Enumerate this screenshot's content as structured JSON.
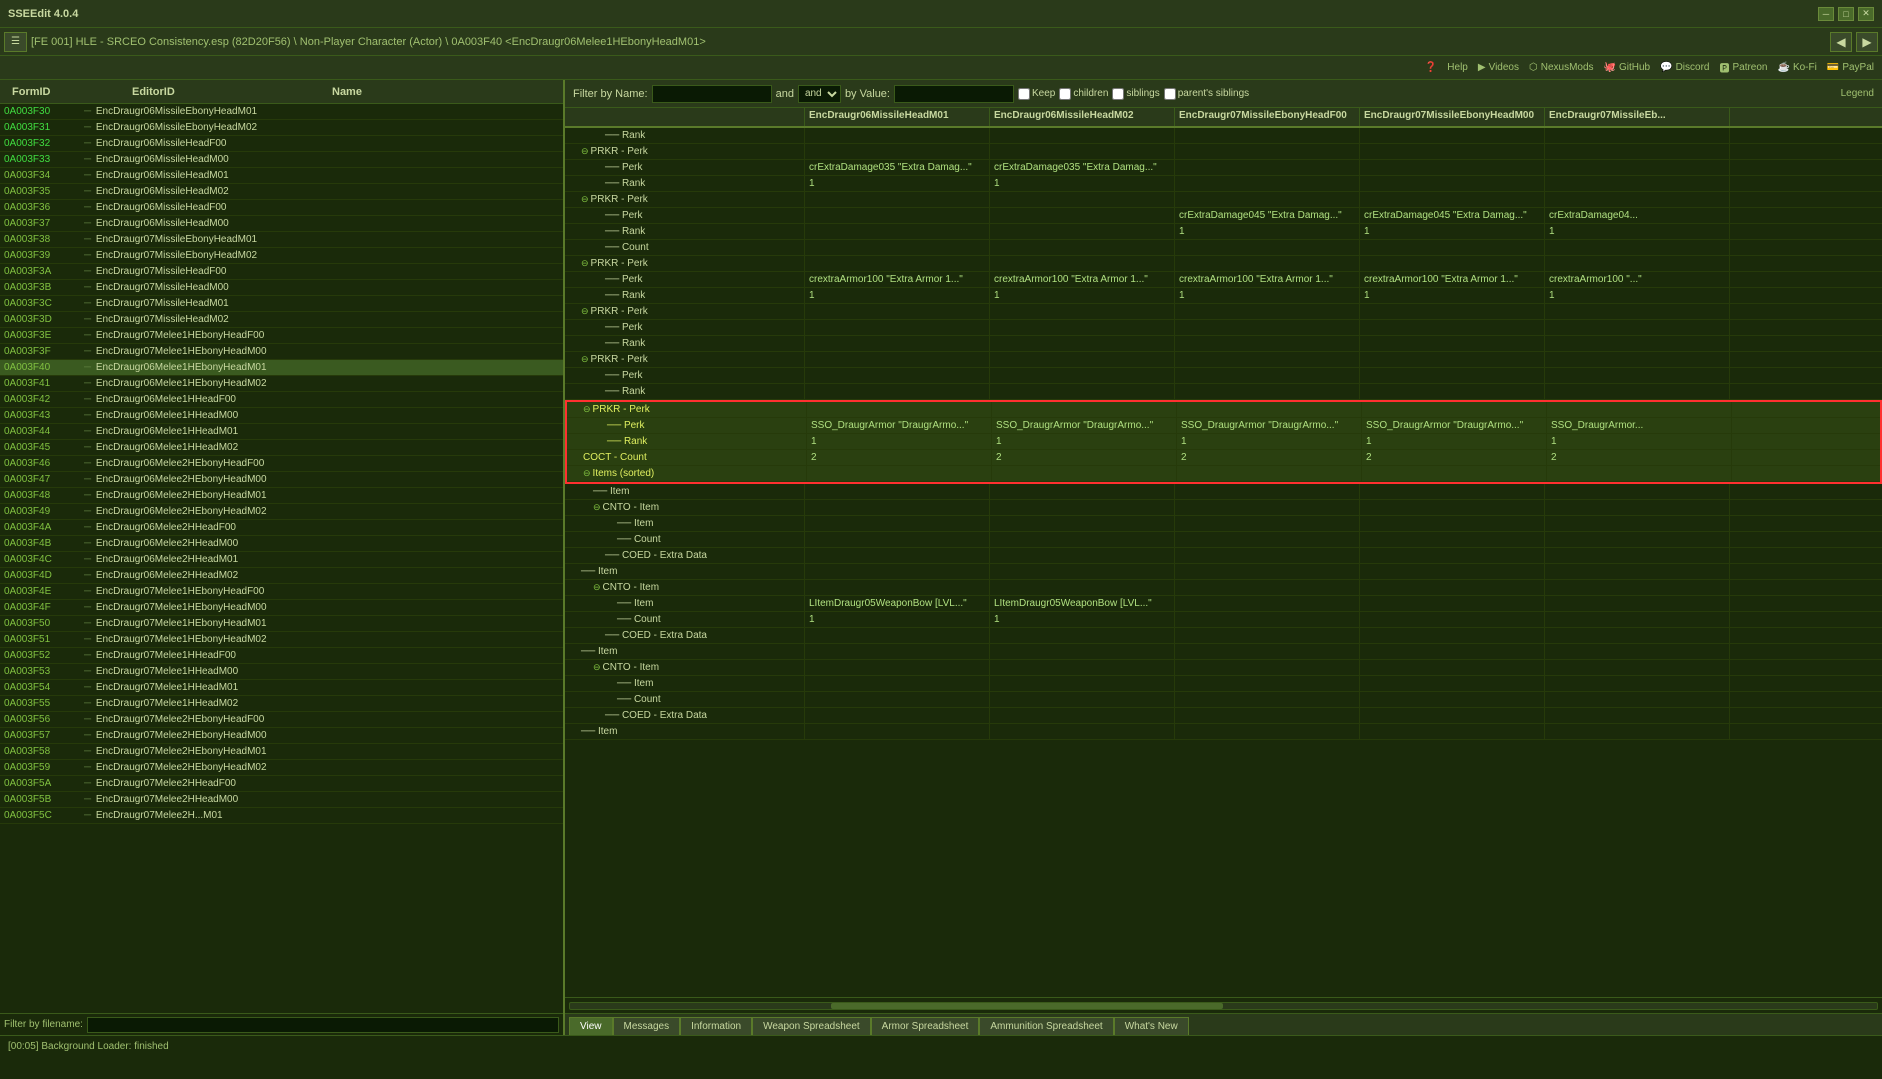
{
  "app": {
    "title": "SSEEdit 4.0.4",
    "version": "4.0.4"
  },
  "window_controls": {
    "minimize": "─",
    "maximize": "□",
    "close": "✕"
  },
  "toolbar": {
    "menu_btn": "☰",
    "breadcrumb": "[FE 001] HLE - SRCEO Consistency.esp (82D20F56) \\ Non-Player Character (Actor) \\ 0A003F40 <EncDraugr06Melee1HEbonyHeadM01>",
    "nav_back": "◀",
    "nav_fwd": "▶"
  },
  "help_toolbar": {
    "help": "Help",
    "videos": "Videos",
    "nexusmods": "NexusMods",
    "github": "GitHub",
    "discord": "Discord",
    "patreon": "Patreon",
    "ko_fi": "Ko-Fi",
    "paypal": "PayPal"
  },
  "left_panel": {
    "col_formid": "FormID",
    "col_editorid": "EditorID",
    "col_name": "Name",
    "filter_label": "Filter by filename:",
    "rows": [
      {
        "formid": "0A003F30",
        "editorid": "EncDraugr06MissileEbonyHeadM01",
        "selected": false,
        "green": true
      },
      {
        "formid": "0A003F31",
        "editorid": "EncDraugr06MissileEbonyHeadM02",
        "selected": false,
        "green": true
      },
      {
        "formid": "0A003F32",
        "editorid": "EncDraugr06MissileHeadF00",
        "selected": false,
        "green": true
      },
      {
        "formid": "0A003F33",
        "editorid": "EncDraugr06MissileHeadM00",
        "selected": false,
        "green": true
      },
      {
        "formid": "0A003F34",
        "editorid": "EncDraugr06MissileHeadM01",
        "selected": false,
        "green": false
      },
      {
        "formid": "0A003F35",
        "editorid": "EncDraugr06MissileHeadM02",
        "selected": false,
        "green": false
      },
      {
        "formid": "0A003F36",
        "editorid": "EncDraugr06MissileHeadF00",
        "selected": false,
        "green": false
      },
      {
        "formid": "0A003F37",
        "editorid": "EncDraugr06MissileHeadM00",
        "selected": false,
        "green": false
      },
      {
        "formid": "0A003F38",
        "editorid": "EncDraugr07MissileEbonyHeadM01",
        "selected": false,
        "green": false
      },
      {
        "formid": "0A003F39",
        "editorid": "EncDraugr07MissileEbonyHeadM02",
        "selected": false,
        "green": false
      },
      {
        "formid": "0A003F3A",
        "editorid": "EncDraugr07MissileHeadF00",
        "selected": false,
        "green": false
      },
      {
        "formid": "0A003F3B",
        "editorid": "EncDraugr07MissileHeadM00",
        "selected": false,
        "green": false
      },
      {
        "formid": "0A003F3C",
        "editorid": "EncDraugr07MissileHeadM01",
        "selected": false,
        "green": false
      },
      {
        "formid": "0A003F3D",
        "editorid": "EncDraugr07MissileHeadM02",
        "selected": false,
        "green": false
      },
      {
        "formid": "0A003F3E",
        "editorid": "EncDraugr07Melee1HEbonyHeadF00",
        "selected": false,
        "green": false
      },
      {
        "formid": "0A003F3F",
        "editorid": "EncDraugr07Melee1HEbonyHeadM00",
        "selected": false,
        "green": false
      },
      {
        "formid": "0A003F40",
        "editorid": "EncDraugr06Melee1HEbonyHeadM01",
        "selected": true,
        "green": false
      },
      {
        "formid": "0A003F41",
        "editorid": "EncDraugr06Melee1HEbonyHeadM02",
        "selected": false,
        "green": false
      },
      {
        "formid": "0A003F42",
        "editorid": "EncDraugr06Melee1HHeadF00",
        "selected": false,
        "green": false
      },
      {
        "formid": "0A003F43",
        "editorid": "EncDraugr06Melee1HHeadM00",
        "selected": false,
        "green": false
      },
      {
        "formid": "0A003F44",
        "editorid": "EncDraugr06Melee1HHeadM01",
        "selected": false,
        "green": false
      },
      {
        "formid": "0A003F45",
        "editorid": "EncDraugr06Melee1HHeadM02",
        "selected": false,
        "green": false
      },
      {
        "formid": "0A003F46",
        "editorid": "EncDraugr06Melee2HEbonyHeadF00",
        "selected": false,
        "green": false
      },
      {
        "formid": "0A003F47",
        "editorid": "EncDraugr06Melee2HEbonyHeadM00",
        "selected": false,
        "green": false
      },
      {
        "formid": "0A003F48",
        "editorid": "EncDraugr06Melee2HEbonyHeadM01",
        "selected": false,
        "green": false
      },
      {
        "formid": "0A003F49",
        "editorid": "EncDraugr06Melee2HEbonyHeadM02",
        "selected": false,
        "green": false
      },
      {
        "formid": "0A003F4A",
        "editorid": "EncDraugr06Melee2HHeadF00",
        "selected": false,
        "green": false
      },
      {
        "formid": "0A003F4B",
        "editorid": "EncDraugr06Melee2HHeadM00",
        "selected": false,
        "green": false
      },
      {
        "formid": "0A003F4C",
        "editorid": "EncDraugr06Melee2HHeadM01",
        "selected": false,
        "green": false
      },
      {
        "formid": "0A003F4D",
        "editorid": "EncDraugr06Melee2HHeadM02",
        "selected": false,
        "green": false
      },
      {
        "formid": "0A003F4E",
        "editorid": "EncDraugr07Melee1HEbonyHeadF00",
        "selected": false,
        "green": false
      },
      {
        "formid": "0A003F4F",
        "editorid": "EncDraugr07Melee1HEbonyHeadM00",
        "selected": false,
        "green": false
      },
      {
        "formid": "0A003F50",
        "editorid": "EncDraugr07Melee1HEbonyHeadM01",
        "selected": false,
        "green": false
      },
      {
        "formid": "0A003F51",
        "editorid": "EncDraugr07Melee1HEbonyHeadM02",
        "selected": false,
        "green": false
      },
      {
        "formid": "0A003F52",
        "editorid": "EncDraugr07Melee1HHeadF00",
        "selected": false,
        "green": false
      },
      {
        "formid": "0A003F53",
        "editorid": "EncDraugr07Melee1HHeadM00",
        "selected": false,
        "green": false
      },
      {
        "formid": "0A003F54",
        "editorid": "EncDraugr07Melee1HHeadM01",
        "selected": false,
        "green": false
      },
      {
        "formid": "0A003F55",
        "editorid": "EncDraugr07Melee1HHeadM02",
        "selected": false,
        "green": false
      },
      {
        "formid": "0A003F56",
        "editorid": "EncDraugr07Melee2HEbonyHeadF00",
        "selected": false,
        "green": false
      },
      {
        "formid": "0A003F57",
        "editorid": "EncDraugr07Melee2HEbonyHeadM00",
        "selected": false,
        "green": false
      },
      {
        "formid": "0A003F58",
        "editorid": "EncDraugr07Melee2HEbonyHeadM01",
        "selected": false,
        "green": false
      },
      {
        "formid": "0A003F59",
        "editorid": "EncDraugr07Melee2HEbonyHeadM02",
        "selected": false,
        "green": false
      },
      {
        "formid": "0A003F5A",
        "editorid": "EncDraugr07Melee2HHeadF00",
        "selected": false,
        "green": false
      },
      {
        "formid": "0A003F5B",
        "editorid": "EncDraugr07Melee2HHeadM00",
        "selected": false,
        "green": false
      },
      {
        "formid": "0A003F5C",
        "editorid": "EncDraugr07Melee2H...M01",
        "selected": false,
        "green": false
      }
    ]
  },
  "filter_bar": {
    "label": "Filter by Name:",
    "value": "",
    "and_label": "and",
    "by_value_label": "by Value:",
    "by_value": "",
    "keep_label": "Keep",
    "children_label": "children",
    "siblings_label": "siblings",
    "parents_siblings_label": "parent's siblings",
    "legend_label": "Legend"
  },
  "grid": {
    "col_headers": [
      "EncDraugr06MissileHeadM01",
      "EncDraugr06MissileHeadM02",
      "EncDraugr07MissileEbonyHeadF00",
      "EncDraugr07MissileEbonyHeadM00",
      "EncDraugr07MissileEb..."
    ],
    "rows": [
      {
        "tree": "── Rank",
        "indent": 3,
        "cells": [
          "",
          "",
          "",
          "",
          ""
        ]
      },
      {
        "tree": "⊖ PRKR - Perk",
        "indent": 1,
        "expand": true,
        "cells": [
          "",
          "",
          "",
          "",
          ""
        ]
      },
      {
        "tree": "── Perk",
        "indent": 3,
        "cells": [
          "crExtraDamage035 \"Extra Damag...\"",
          "crExtraDamage035 \"Extra Damag...\"",
          "",
          "",
          ""
        ]
      },
      {
        "tree": "── Rank",
        "indent": 3,
        "cells": [
          "1",
          "1",
          "",
          "",
          ""
        ]
      },
      {
        "tree": "⊖ PRKR - Perk",
        "indent": 1,
        "expand": true,
        "cells": [
          "",
          "",
          "",
          "",
          ""
        ]
      },
      {
        "tree": "── Perk",
        "indent": 3,
        "cells": [
          "",
          "",
          "crExtraDamage045 \"Extra Damag...\"",
          "crExtraDamage045 \"Extra Damag...\"",
          "crExtraDamage04..."
        ]
      },
      {
        "tree": "── Rank",
        "indent": 3,
        "cells": [
          "",
          "",
          "1",
          "1",
          "1"
        ]
      },
      {
        "tree": "── Count",
        "indent": 3,
        "cells": [
          "",
          "",
          "",
          "",
          ""
        ]
      },
      {
        "tree": "⊖ PRKR - Perk",
        "indent": 1,
        "expand": true,
        "cells": [
          "",
          "",
          "",
          "",
          ""
        ]
      },
      {
        "tree": "── Perk",
        "indent": 3,
        "cells": [
          "crextraArmor100 \"Extra Armor 1...\"",
          "crextraArmor100 \"Extra Armor 1...\"",
          "crextraArmor100 \"Extra Armor 1...\"",
          "crextraArmor100 \"Extra Armor 1...\"",
          "crextraArmor100 \"...\""
        ]
      },
      {
        "tree": "── Rank",
        "indent": 3,
        "cells": [
          "1",
          "1",
          "1",
          "1",
          "1"
        ]
      },
      {
        "tree": "⊖ PRKR - Perk",
        "indent": 1,
        "expand": true,
        "cells": [
          "",
          "",
          "",
          "",
          ""
        ]
      },
      {
        "tree": "── Perk",
        "indent": 3,
        "cells": [
          "",
          "",
          "",
          "",
          ""
        ]
      },
      {
        "tree": "── Rank",
        "indent": 3,
        "cells": [
          "",
          "",
          "",
          "",
          ""
        ]
      },
      {
        "tree": "⊖ PRKR - Perk",
        "indent": 1,
        "expand": true,
        "cells": [
          "",
          "",
          "",
          "",
          ""
        ]
      },
      {
        "tree": "── Perk",
        "indent": 3,
        "cells": [
          "",
          "",
          "",
          "",
          ""
        ]
      },
      {
        "tree": "── Rank",
        "indent": 3,
        "cells": [
          "",
          "",
          "",
          "",
          ""
        ]
      },
      {
        "tree": "⊖ PRKR - Perk",
        "indent": 1,
        "expand": true,
        "cells": [
          "",
          "",
          "",
          "",
          ""
        ],
        "red": true
      },
      {
        "tree": "── Perk",
        "indent": 3,
        "cells": [
          "SSO_DraugrArmor \"DraugrArmo...\"",
          "SSO_DraugrArmor \"DraugrArmo...\"",
          "SSO_DraugrArmor \"DraugrArmo...\"",
          "SSO_DraugrArmor \"DraugrArmo...\"",
          "SSO_DraugrArmor..."
        ],
        "red": true
      },
      {
        "tree": "── Rank",
        "indent": 3,
        "cells": [
          "1",
          "1",
          "1",
          "1",
          "1"
        ],
        "red": true
      },
      {
        "tree": "COCT - Count",
        "indent": 1,
        "cells": [
          "2",
          "2",
          "2",
          "2",
          "2"
        ],
        "red": true
      },
      {
        "tree": "⊖ Items (sorted)",
        "indent": 1,
        "expand": true,
        "cells": [
          "",
          "",
          "",
          "",
          ""
        ],
        "red": true
      },
      {
        "tree": "── Item",
        "indent": 2,
        "cells": [
          "",
          "",
          "",
          "",
          ""
        ]
      },
      {
        "tree": "⊖ CNTO - Item",
        "indent": 2,
        "expand": true,
        "cells": [
          "",
          "",
          "",
          "",
          ""
        ]
      },
      {
        "tree": "── Item",
        "indent": 4,
        "cells": [
          "",
          "",
          "",
          "",
          ""
        ]
      },
      {
        "tree": "── Count",
        "indent": 4,
        "cells": [
          "",
          "",
          "",
          "",
          ""
        ]
      },
      {
        "tree": "── COED - Extra Data",
        "indent": 3,
        "cells": [
          "",
          "",
          "",
          "",
          ""
        ]
      },
      {
        "tree": "── Item",
        "indent": 1,
        "cells": [
          "",
          "",
          "",
          "",
          ""
        ]
      },
      {
        "tree": "⊖ CNTO - Item",
        "indent": 2,
        "expand": true,
        "cells": [
          "",
          "",
          "",
          "",
          ""
        ]
      },
      {
        "tree": "── Item",
        "indent": 4,
        "cells": [
          "LItemDraugr05WeaponBow [LVL...\"",
          "LItemDraugr05WeaponBow [LVL...\"",
          "",
          "",
          ""
        ]
      },
      {
        "tree": "── Count",
        "indent": 4,
        "cells": [
          "1",
          "1",
          "",
          "",
          ""
        ]
      },
      {
        "tree": "── COED - Extra Data",
        "indent": 3,
        "cells": [
          "",
          "",
          "",
          "",
          ""
        ]
      },
      {
        "tree": "── Item",
        "indent": 1,
        "cells": [
          "",
          "",
          "",
          "",
          ""
        ]
      },
      {
        "tree": "⊖ CNTO - Item",
        "indent": 2,
        "expand": true,
        "cells": [
          "",
          "",
          "",
          "",
          ""
        ]
      },
      {
        "tree": "── Item",
        "indent": 4,
        "cells": [
          "",
          "",
          "",
          "",
          ""
        ]
      },
      {
        "tree": "── Count",
        "indent": 4,
        "cells": [
          "",
          "",
          "",
          "",
          ""
        ]
      },
      {
        "tree": "── COED - Extra Data",
        "indent": 3,
        "cells": [
          "",
          "",
          "",
          "",
          ""
        ]
      },
      {
        "tree": "── Item",
        "indent": 1,
        "cells": [
          "",
          "",
          "",
          "",
          ""
        ]
      }
    ]
  },
  "bottom_tabs": {
    "tabs": [
      {
        "label": "View",
        "active": true
      },
      {
        "label": "Messages",
        "active": false
      },
      {
        "label": "Information",
        "active": false
      },
      {
        "label": "Weapon Spreadsheet",
        "active": false
      },
      {
        "label": "Armor Spreadsheet",
        "active": false
      },
      {
        "label": "Ammunition Spreadsheet",
        "active": false
      },
      {
        "label": "What's New",
        "active": false
      }
    ]
  },
  "status_bar": {
    "text": "[00:05] Background Loader: finished"
  }
}
